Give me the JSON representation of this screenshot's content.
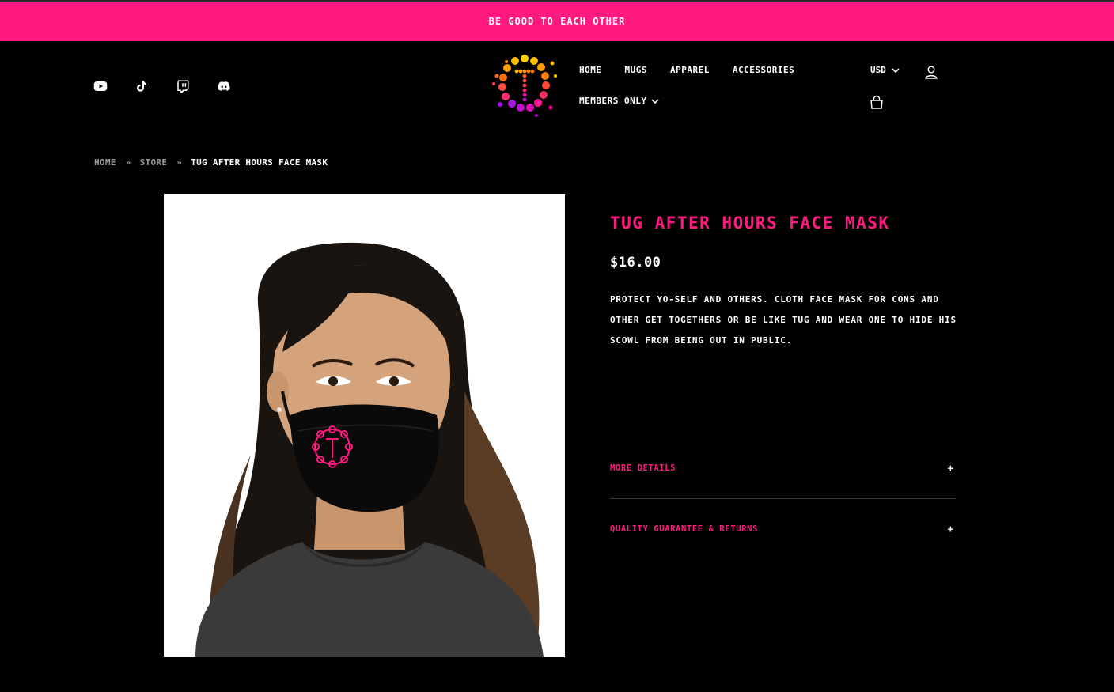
{
  "announcement": "Be good to each other",
  "social": {
    "icons": [
      "youtube-icon",
      "tiktok-icon",
      "twitch-icon",
      "discord-icon"
    ]
  },
  "nav": {
    "items": [
      "Home",
      "Mugs",
      "Apparel",
      "Accessories"
    ],
    "members": "Members only"
  },
  "header_tools": {
    "currency": "USD",
    "user_icon": "user-icon",
    "bag_icon": "bag-icon"
  },
  "breadcrumb": {
    "items": [
      "Home",
      "Store"
    ],
    "current": "TUG After Hours Face Mask",
    "separator": "»"
  },
  "product": {
    "title": "TUG After Hours Face Mask",
    "price": "$16.00",
    "description": "Protect yo-self and others. Cloth face mask for cons and other get togethers or be like TUG and wear one to hide his scowl from being out in public."
  },
  "accordions": [
    {
      "label": "More details",
      "icon": "+"
    },
    {
      "label": "Quality Guarantee & Returns",
      "icon": "+"
    }
  ],
  "colors": {
    "accent": "#ff1a80",
    "background": "#000000",
    "text": "#ffffff"
  }
}
